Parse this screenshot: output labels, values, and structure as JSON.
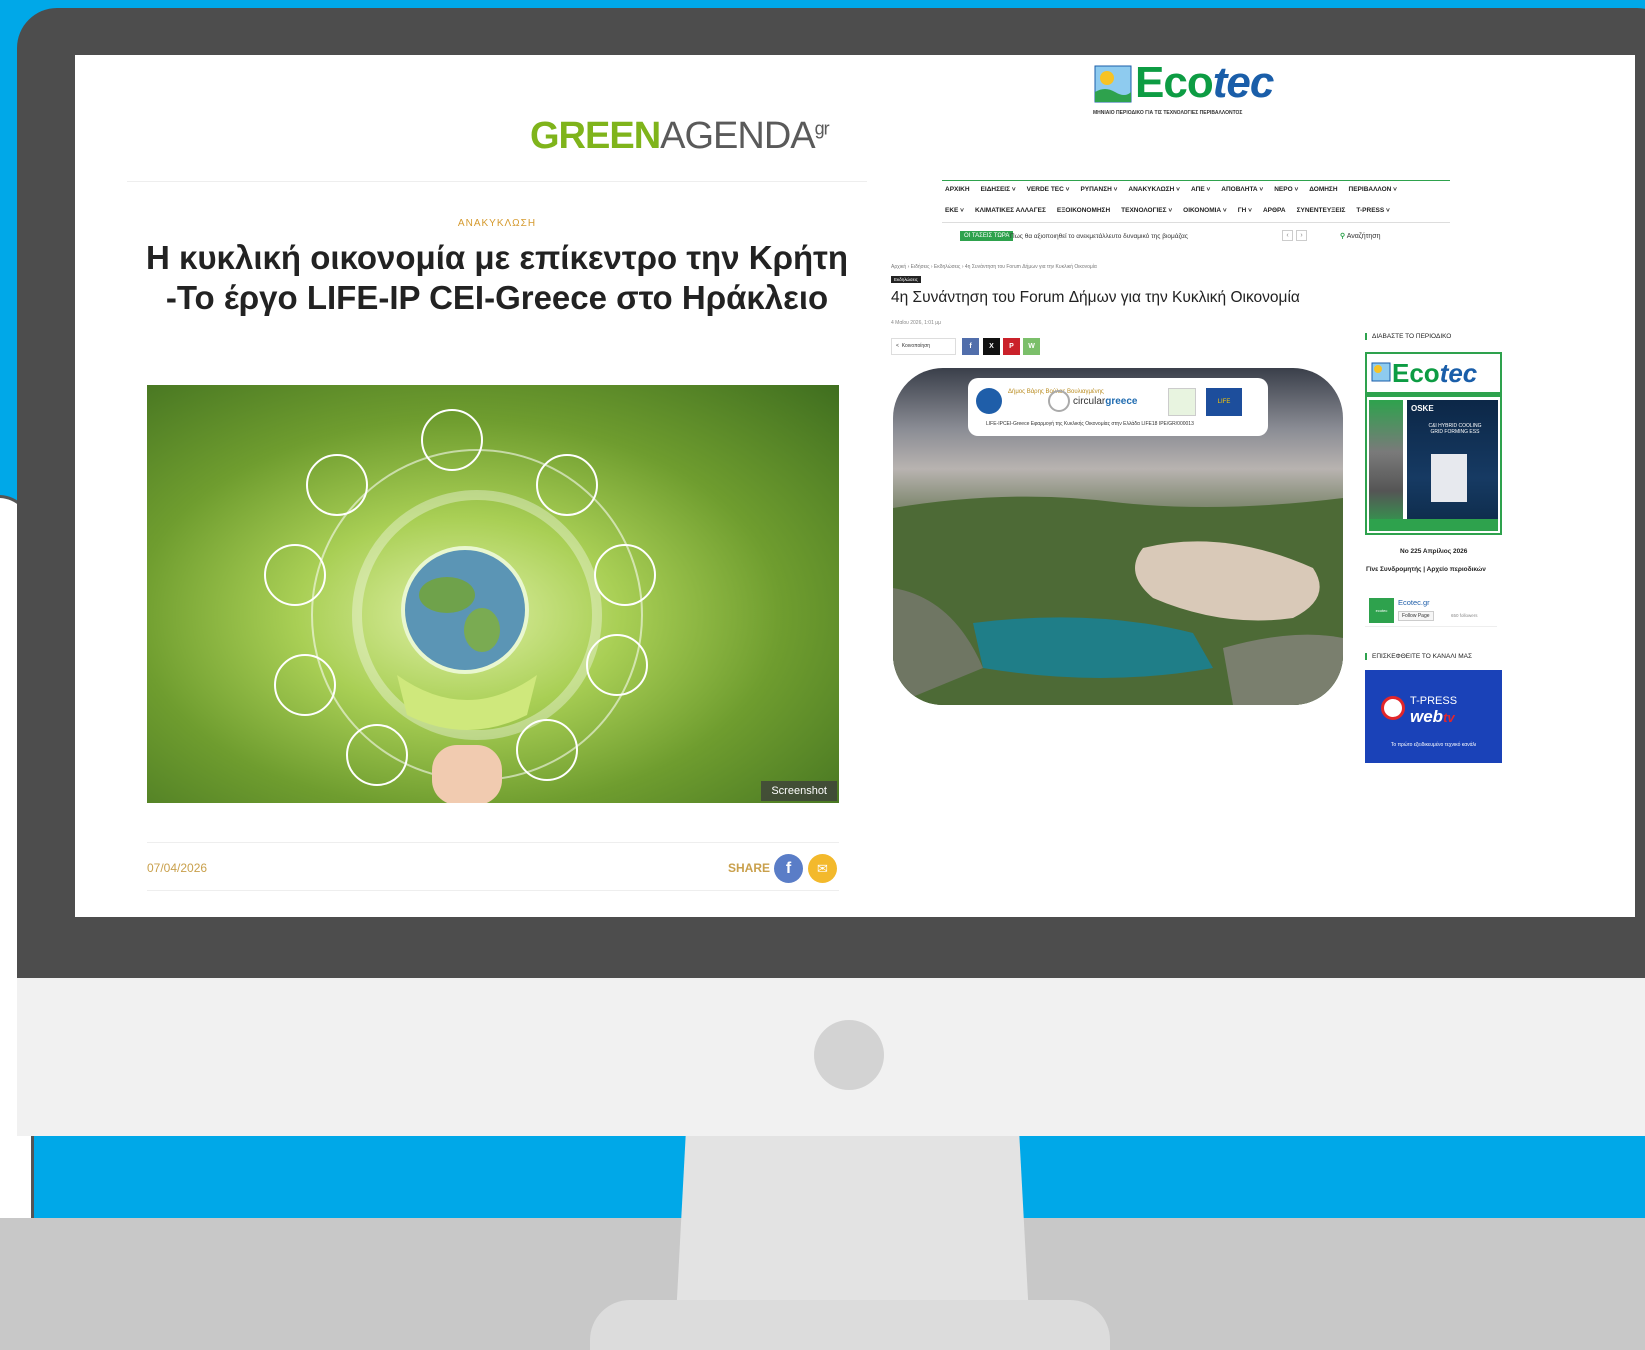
{
  "greenagenda": {
    "logo_green": "GREEN",
    "logo_gray": "AGENDA",
    "logo_sup": "gr",
    "category": "ΑΝΑΚΥΚΛΩΣΗ",
    "title": "Η κυκλική οικονομία με επίκεντρο την Κρήτη -Το έργο LIFE-IP CEI-Greece στο Ηράκλειο",
    "image_tag": "Screenshot",
    "date": "07/04/2026",
    "share_label": "SHARE",
    "share_fb": "f",
    "share_mail": "✉"
  },
  "ecotec": {
    "logo_a": "Eco",
    "logo_b": "tec",
    "logo_sub": "ΜΗΝΙΑΙΟ ΠΕΡΙΟΔΙΚΟ ΓΙΑ ΤΙΣ ΤΕΧΝΟΛΟΓΙΕΣ ΠΕΡΙΒΑΛΛΟΝΤΟΣ",
    "menu_row1": [
      "ΑΡΧΙΚΗ",
      "ΕΙΔΗΣΕΙΣ ˅",
      "VERDE TEC ˅",
      "ΡΥΠΑΝΣΗ ˅",
      "ΑΝΑΚΥΚΛΩΣΗ ˅",
      "ΑΠΕ ˅",
      "ΑΠΟΒΛΗΤΑ ˅",
      "ΝΕΡΟ ˅",
      "ΔΟΜΗΣΗ",
      "ΠΕΡΙΒΑΛΛΟΝ ˅"
    ],
    "menu_row2": [
      "ΕΚΕ ˅",
      "ΚΛΙΜΑΤΙΚΕΣ ΑΛΛΑΓΕΣ",
      "ΕΞΟΙΚΟΝΟΜΗΣΗ",
      "ΤΕΧΝΟΛΟΓΙΕΣ ˅",
      "ΟΙΚΟΝΟΜΙΑ ˅",
      "ΓΗ ˅",
      "ΑΡΘΡΑ",
      "ΣΥΝΕΝΤΕΥΞΕΙΣ",
      "T-PRESS ˅"
    ],
    "hot_label": "ΟΙ ΤΑΣΕΙΣ ΤΩΡΑ",
    "hot_text": "Πως θα αξιοποιηθεί το ανεκμετάλλευτο δυναμικό της βιομάζας",
    "search_label": "Αναζήτηση",
    "breadcrumb": "Αρχική › Ειδήσεις › Εκδηλώσεις › 4η Συνάντηση του Forum Δήμων για την Κυκλική Οικονομία",
    "badge": "Εκδηλώσεις",
    "title": "4η Συνάντηση του Forum Δήμων για την Κυκλική Οικονομία",
    "date": "4 Μαΐου 2026, 1:01 μμ",
    "share_label": "Κοινοποίηση",
    "share_buttons": [
      "f",
      "X",
      "P",
      "W"
    ],
    "banner_municipality": "Δήμος Βάρης Βούλας Βουλιαγμένης",
    "banner_circular_a": "circular",
    "banner_circular_b": "greece",
    "banner_caption": "LIFE-IPCEI-Greece Εφαρμογή της Κυκλικής Οικονομίας στην Ελλάδα LIFE18 IPE/GR/000013",
    "banner_eu": "LIFE",
    "sidebar_magazine_heading": "ΔΙΑΒΑΣΤΕ ΤΟ ΠΕΡΙΟΔΙΚΟ",
    "mag_brand": "OSKE",
    "mag_cooling": "C&I HYBRID COOLING GRID FORMING ESS",
    "mag_issue": "Νο 225 Απρίλιος 2026",
    "mag_links": "Γίνε Συνδρομητής | Αρχείο περιοδικών",
    "fb_name": "Ecotec.gr",
    "fb_follow": "Follow Page",
    "fb_followers": "650 followers",
    "sidebar_channel_heading": "ΕΠΙΣΚΕΦΘΕΙΤΕ ΤΟ ΚΑΝΑΛΙ ΜΑΣ",
    "tpress_name": "T-PRESS",
    "tpress_web": "web",
    "tpress_tv": "tv",
    "tpress_caption": "Το πρώτο εξειδικευμένο τεχνικό κανάλι"
  }
}
